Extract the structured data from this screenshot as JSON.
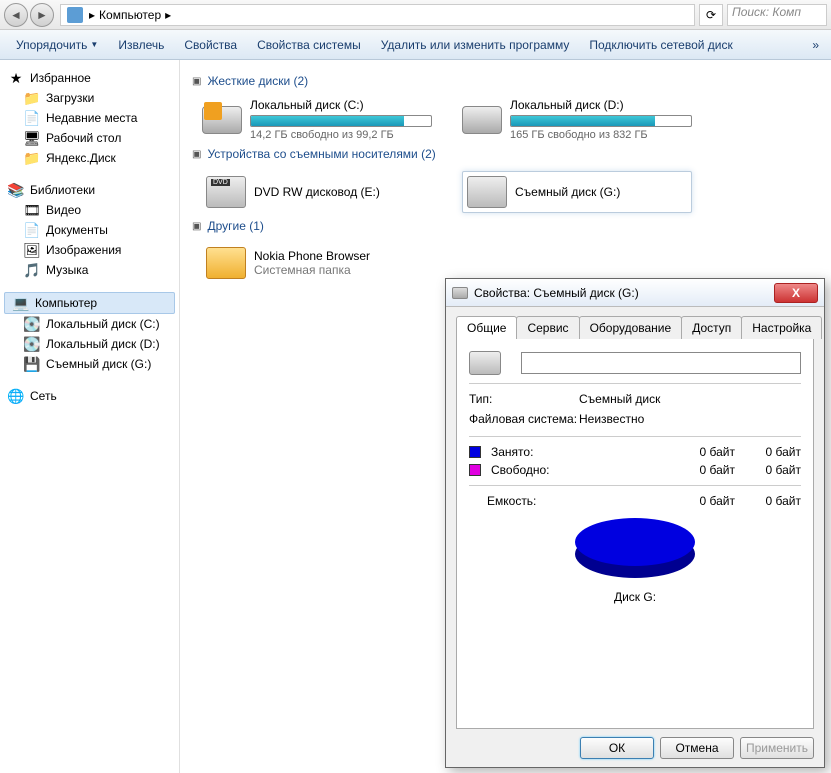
{
  "breadcrumb": {
    "root": "Компьютер",
    "sep": "▸"
  },
  "search": {
    "placeholder": "Поиск: Комп"
  },
  "toolbar": {
    "organize": "Упорядочить",
    "eject": "Извлечь",
    "properties": "Свойства",
    "sysprops": "Свойства системы",
    "uninstall": "Удалить или изменить программу",
    "mapdrive": "Подключить сетевой диск",
    "overflow": "»"
  },
  "sidebar": {
    "favorites": {
      "label": "Избранное",
      "items": [
        "Загрузки",
        "Недавние места",
        "Рабочий стол",
        "Яндекс.Диск"
      ]
    },
    "libraries": {
      "label": "Библиотеки",
      "items": [
        "Видео",
        "Документы",
        "Изображения",
        "Музыка"
      ]
    },
    "computer": {
      "label": "Компьютер",
      "items": [
        "Локальный диск (C:)",
        "Локальный диск (D:)",
        "Съемный диск (G:)"
      ]
    },
    "network": {
      "label": "Сеть"
    }
  },
  "sections": {
    "hdd": {
      "title": "Жесткие диски (2)"
    },
    "removable": {
      "title": "Устройства со съемными носителями (2)"
    },
    "other": {
      "title": "Другие (1)"
    }
  },
  "drives": {
    "c": {
      "name": "Локальный диск (C:)",
      "meta": "14,2 ГБ свободно из 99,2 ГБ",
      "fillPercent": 85
    },
    "d": {
      "name": "Локальный диск (D:)",
      "meta": "165 ГБ свободно из 832 ГБ",
      "fillPercent": 80
    }
  },
  "devices": {
    "dvd": {
      "name": "DVD RW дисковод (E:)"
    },
    "usb": {
      "name": "Съемный диск (G:)"
    }
  },
  "other": {
    "nokia": {
      "name": "Nokia Phone Browser",
      "meta": "Системная папка"
    }
  },
  "dialog": {
    "title": "Свойства: Съемный диск (G:)",
    "tabs": [
      "Общие",
      "Сервис",
      "Оборудование",
      "Доступ",
      "Настройка"
    ],
    "type_label": "Тип:",
    "type_value": "Съемный диск",
    "fs_label": "Файловая система:",
    "fs_value": "Неизвестно",
    "used_label": "Занято:",
    "free_label": "Свободно:",
    "used_bytes": "0 байт",
    "used_human": "0 байт",
    "free_bytes": "0 байт",
    "free_human": "0 байт",
    "capacity_label": "Емкость:",
    "capacity_bytes": "0 байт",
    "capacity_human": "0 байт",
    "disk_label": "Диск G:",
    "used_color": "#0000e0",
    "free_color": "#e000e0",
    "buttons": {
      "ok": "ОК",
      "cancel": "Отмена",
      "apply": "Применить"
    }
  }
}
